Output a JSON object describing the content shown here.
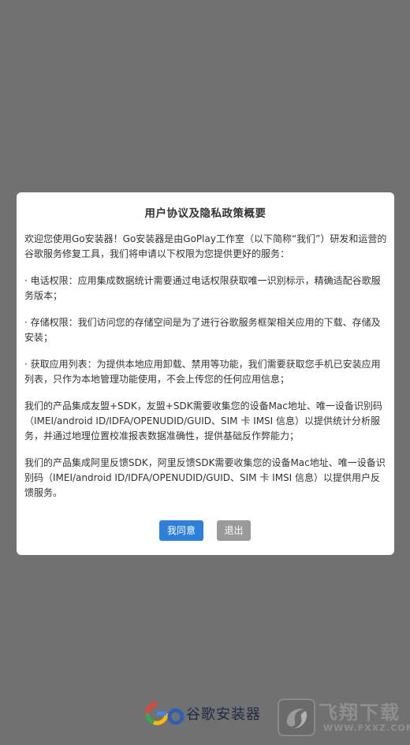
{
  "dialog": {
    "title": "用户协议及隐私政策概要",
    "paragraphs": [
      "欢迎您使用Go安装器！Go安装器是由GoPlay工作室（以下简称“我们”）研发和运营的谷歌服务修复工具，我们将申请以下权限为您提供更好的服务：",
      "· 电话权限：应用集成数据统计需要通过电话权限获取唯一识别标示，精确适配谷歌服务版本；",
      "· 存储权限：我们访问您的存储空间是为了进行谷歌服务框架相关应用的下载、存储及安装；",
      "· 获取应用列表：为提供本地应用卸载、禁用等功能，我们需要获取您手机已安装应用列表，只作为本地管理功能使用，不会上传您的任何应用信息；",
      "我们的产品集成友盟+SDK，友盟+SDK需要收集您的设备Mac地址、唯一设备识别码（IMEI/android ID/IDFA/OPENUDID/GUID、SIM 卡 IMSI 信息）以提供统计分析服务，并通过地理位置校准报表数据准确性，提供基础反作弊能力；",
      "我们的产品集成阿里反馈SDK，阿里反馈SDK需要收集您的设备Mac地址、唯一设备识别码（IMEI/android ID/IDFA/OPENUDID/GUID、SIM 卡 IMSI 信息）以提供用户反馈服务。"
    ],
    "agree_label": "我同意",
    "exit_label": "退出"
  },
  "brand": {
    "name": "谷歌安装器",
    "logo_icon": "go-logo-icon"
  },
  "watermark": {
    "text": "飞翔下载",
    "url": "WWW.FXXZ.COM"
  },
  "colors": {
    "overlay": "#717171",
    "agree_button": "#2d7fd9",
    "exit_button": "#9a9a9a"
  }
}
